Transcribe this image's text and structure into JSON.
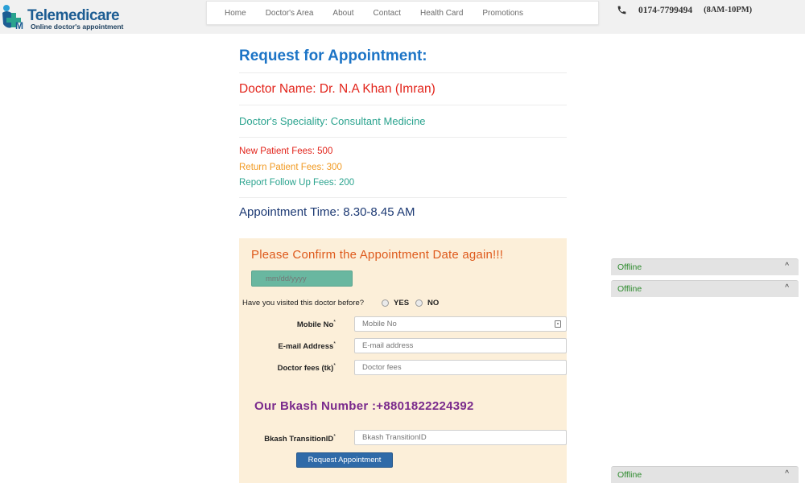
{
  "brand": {
    "name": "Telemedicare",
    "tagline": "Online doctor's appointment"
  },
  "nav": {
    "items": [
      "Home",
      "Doctor's Area",
      "About",
      "Contact",
      "Health Card",
      "Promotions"
    ]
  },
  "contact": {
    "phone": "0174-7799494",
    "hours": "(8AM-10PM)"
  },
  "appointment": {
    "title": "Request for Appointment:",
    "doctor_name": "Doctor Name: Dr. N.A Khan (Imran)",
    "speciality": "Doctor's Speciality: Consultant Medicine",
    "fees": {
      "new": "New Patient Fees: 500",
      "return": "Return Patient Fees: 300",
      "report": "Report Follow Up Fees: 200"
    },
    "time": "Appointment Time: 8.30-8.45 AM"
  },
  "form": {
    "confirm_text": "Please Confirm the Appointment Date again!!!",
    "date_placeholder": "mm/dd/yyyy",
    "visited_question": "Have you visited this doctor before?",
    "yes_label": "YES",
    "no_label": "NO",
    "mobile_label": "Mobile No",
    "mobile_placeholder": "Mobile No",
    "email_label": "E-mail Address",
    "email_placeholder": "E-mail address",
    "fees_label": "Doctor fees (tk)",
    "fees_placeholder": "Doctor fees",
    "required_mark": "*",
    "bkash_number": "Our Bkash Number :+8801822224392",
    "bkash_label": "Bkash TransitionID",
    "bkash_placeholder": "Bkash TransitionID",
    "submit_label": "Request Appointment"
  },
  "chat": {
    "status": "Offline",
    "chevron": "^"
  },
  "colors": {
    "title_blue": "#1c74c6",
    "doctor_red": "#e2231a",
    "speciality_teal": "#2aa38e",
    "return_orange": "#f19a22",
    "time_navy": "#1d3a74",
    "panel_bg": "#fcefd9",
    "confirm_orange": "#de5a1c",
    "bkash_purple": "#7a2a8c",
    "button_blue": "#2f6aa8",
    "offline_green": "#2e8b2e"
  },
  "icons": {
    "logo": "telemedicare-logo-icon",
    "phone": "phone-icon",
    "contact_card": "contact-card-icon",
    "chevron": "chevron-up-icon"
  }
}
